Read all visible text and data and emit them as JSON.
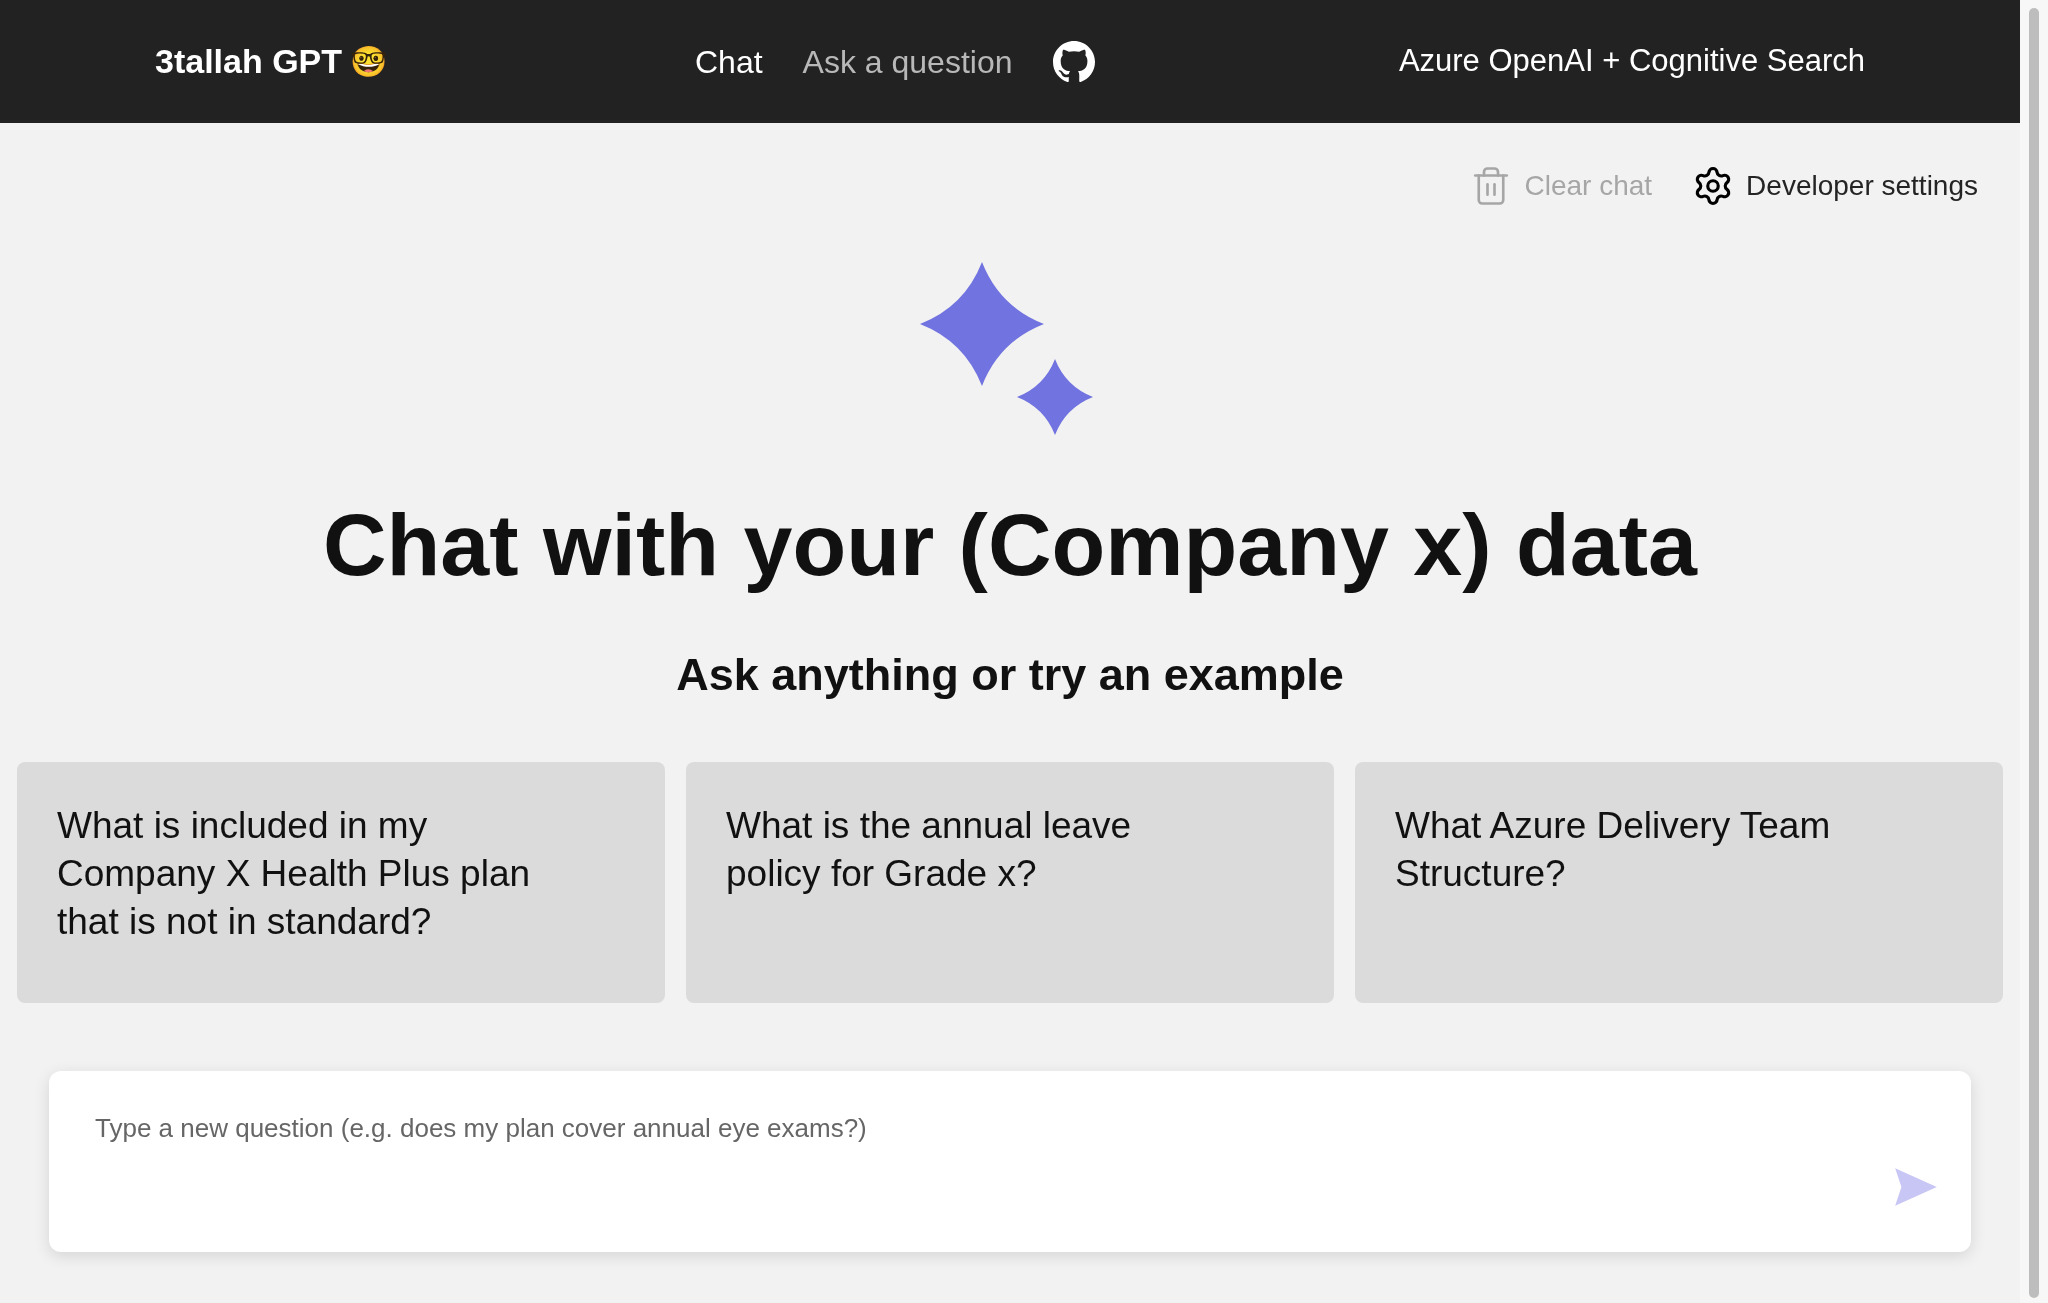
{
  "header": {
    "title": "3tallah GPT",
    "title_emoji": "🤓",
    "nav": [
      {
        "label": "Chat",
        "selected": true
      },
      {
        "label": "Ask a question",
        "selected": false
      }
    ],
    "right_text": "Azure OpenAI + Cognitive Search"
  },
  "toolbar": [
    {
      "label": "Clear chat",
      "kind": "clear",
      "disabled": true
    },
    {
      "label": "Developer settings",
      "kind": "settings",
      "disabled": false
    }
  ],
  "heading": "Chat with your (Company x) data",
  "subheading": "Ask anything or try an example",
  "examples": [
    "What is included in my Company X Health Plus plan that is not in standard?",
    "What is the annual leave policy for Grade x?",
    "What Azure Delivery Team Structure?"
  ],
  "question_input": {
    "placeholder": "Type a new question (e.g. does my plan cover annual eye exams?)"
  }
}
